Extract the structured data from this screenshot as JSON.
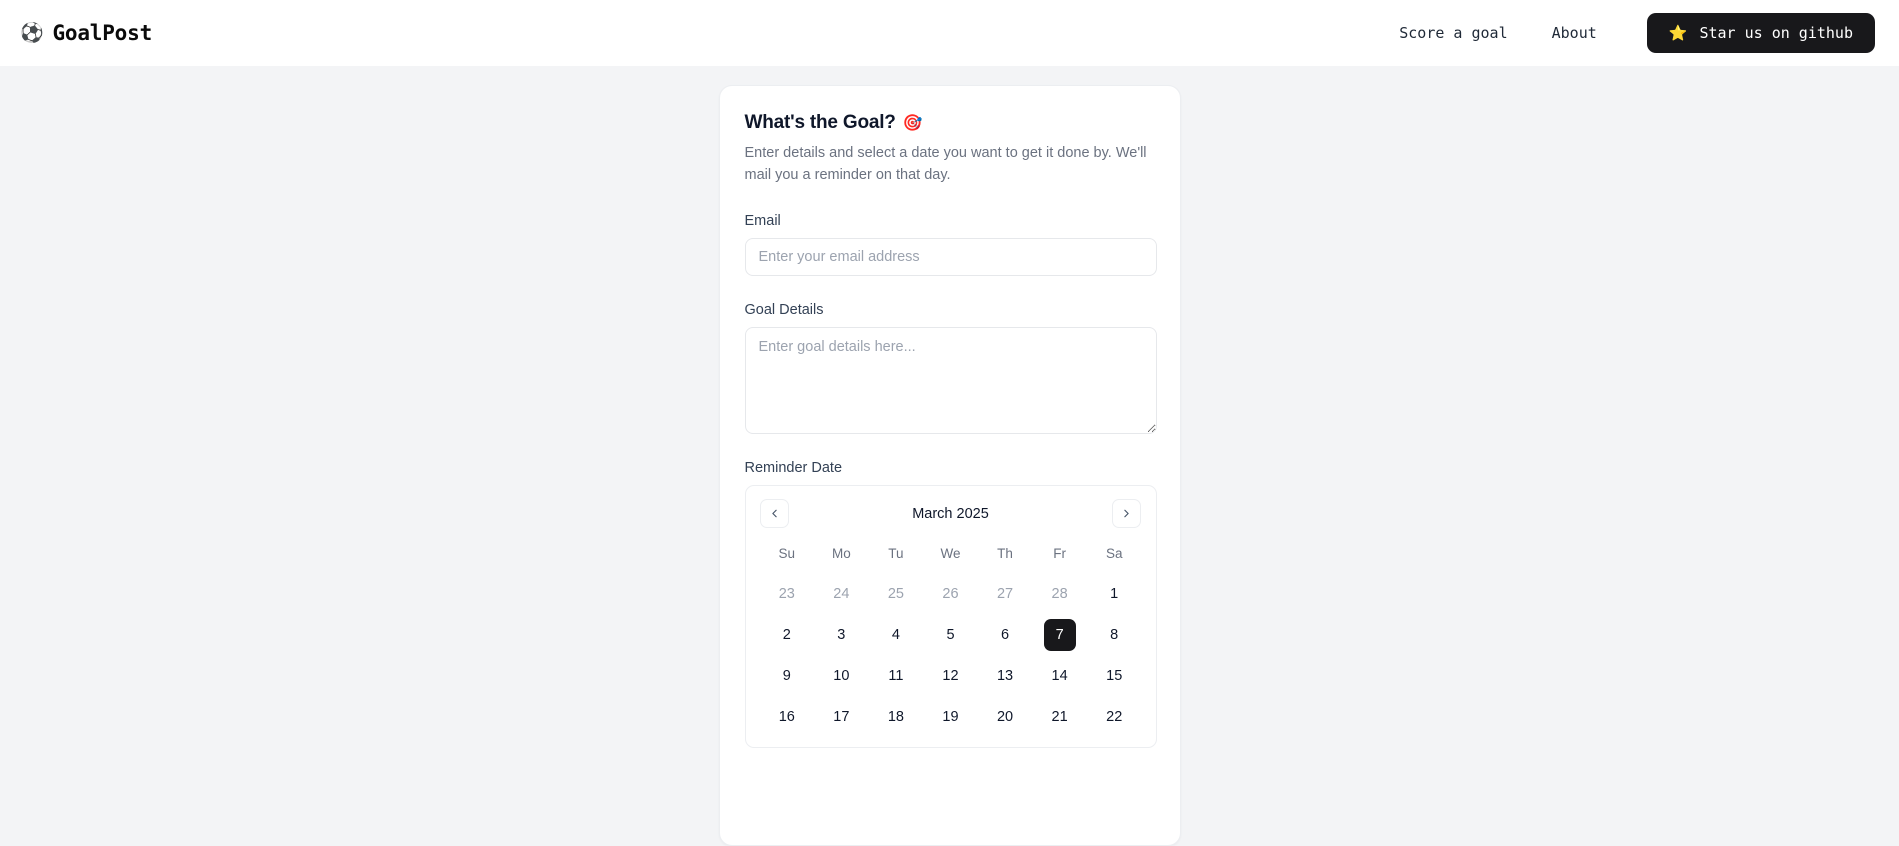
{
  "header": {
    "brand": {
      "icon": "soccer-ball-icon",
      "glyph": "⚽",
      "label": "GoalPost"
    },
    "nav": [
      {
        "label": "Score a goal",
        "name": "nav-link-score-a-goal"
      },
      {
        "label": "About",
        "name": "nav-link-about"
      }
    ],
    "github_button": {
      "label": "Star us on github",
      "glyph": "⭐",
      "icon": "star-icon",
      "bg": "#18181b",
      "star_color": "#f5a623"
    }
  },
  "card": {
    "title": "What's the Goal?",
    "title_emoji": "🎯",
    "description": "Enter details and select a date you want to get it done by. We'll mail you a reminder on that day.",
    "fields": {
      "email": {
        "label": "Email",
        "placeholder": "Enter your email address",
        "value": ""
      },
      "goal_details": {
        "label": "Goal Details",
        "placeholder": "Enter goal details here...",
        "value": ""
      },
      "reminder_date": {
        "label": "Reminder Date"
      }
    }
  },
  "calendar": {
    "month_label": "March 2025",
    "prev_icon": "chevron-left-icon",
    "next_icon": "chevron-right-icon",
    "weekdays": [
      "Su",
      "Mo",
      "Tu",
      "We",
      "Th",
      "Fr",
      "Sa"
    ],
    "selected_day": 7,
    "selected_color": "#18181b",
    "weeks": [
      [
        {
          "d": "23",
          "muted": true
        },
        {
          "d": "24",
          "muted": true
        },
        {
          "d": "25",
          "muted": true
        },
        {
          "d": "26",
          "muted": true
        },
        {
          "d": "27",
          "muted": true
        },
        {
          "d": "28",
          "muted": true
        },
        {
          "d": "1",
          "muted": false
        }
      ],
      [
        {
          "d": "2",
          "muted": false
        },
        {
          "d": "3",
          "muted": false
        },
        {
          "d": "4",
          "muted": false
        },
        {
          "d": "5",
          "muted": false
        },
        {
          "d": "6",
          "muted": false
        },
        {
          "d": "7",
          "muted": false,
          "selected": true
        },
        {
          "d": "8",
          "muted": false
        }
      ],
      [
        {
          "d": "9",
          "muted": false
        },
        {
          "d": "10",
          "muted": false
        },
        {
          "d": "11",
          "muted": false
        },
        {
          "d": "12",
          "muted": false
        },
        {
          "d": "13",
          "muted": false
        },
        {
          "d": "14",
          "muted": false
        },
        {
          "d": "15",
          "muted": false
        }
      ],
      [
        {
          "d": "16",
          "muted": false
        },
        {
          "d": "17",
          "muted": false
        },
        {
          "d": "18",
          "muted": false
        },
        {
          "d": "19",
          "muted": false
        },
        {
          "d": "20",
          "muted": false
        },
        {
          "d": "21",
          "muted": false
        },
        {
          "d": "22",
          "muted": false
        }
      ]
    ]
  },
  "theme": {
    "page_bg": "#f3f4f6",
    "card_bg": "#ffffff",
    "border": "#eceef1",
    "text": "#0f172a",
    "muted_text": "#6b7280"
  }
}
